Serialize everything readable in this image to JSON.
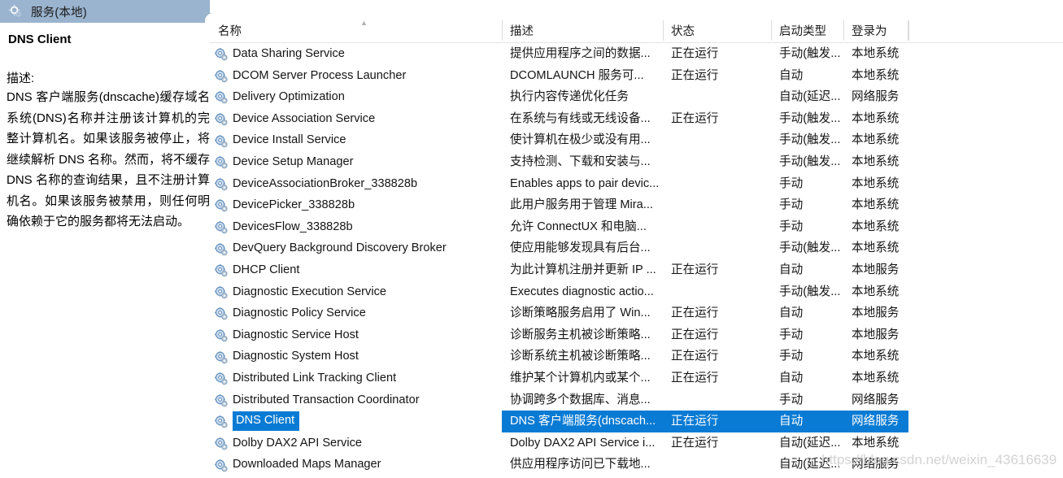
{
  "window": {
    "title": "服务(本地)",
    "title_icon": "services-gear-icon"
  },
  "detail_pane": {
    "service_name": "DNS Client",
    "description_label": "描述:",
    "description_text": "DNS 客户端服务(dnscache)缓存域名系统(DNS)名称并注册该计算机的完整计算机名。如果该服务被停止，将继续解析 DNS 名称。然而，将不缓存 DNS 名称的查询结果，且不注册计算机名。如果该服务被禁用，则任何明确依赖于它的服务都将无法启动。"
  },
  "list": {
    "columns": [
      {
        "key": "name",
        "label": "名称",
        "sorted": "asc",
        "sort_glyph": "▲"
      },
      {
        "key": "description",
        "label": "描述"
      },
      {
        "key": "status",
        "label": "状态"
      },
      {
        "key": "startup_type",
        "label": "启动类型"
      },
      {
        "key": "log_on_as",
        "label": "登录为"
      }
    ],
    "selected_index": 17,
    "selection_color": "#0a7bd4",
    "rows": [
      {
        "name": "Data Sharing Service",
        "description": "提供应用程序之间的数据...",
        "status": "正在运行",
        "startup_type": "手动(触发...",
        "log_on_as": "本地系统"
      },
      {
        "name": "DCOM Server Process Launcher",
        "description": "DCOMLAUNCH 服务可...",
        "status": "正在运行",
        "startup_type": "自动",
        "log_on_as": "本地系统"
      },
      {
        "name": "Delivery Optimization",
        "description": "执行内容传递优化任务",
        "status": "",
        "startup_type": "自动(延迟...",
        "log_on_as": "网络服务"
      },
      {
        "name": "Device Association Service",
        "description": "在系统与有线或无线设备...",
        "status": "正在运行",
        "startup_type": "手动(触发...",
        "log_on_as": "本地系统"
      },
      {
        "name": "Device Install Service",
        "description": "使计算机在极少或没有用...",
        "status": "",
        "startup_type": "手动(触发...",
        "log_on_as": "本地系统"
      },
      {
        "name": "Device Setup Manager",
        "description": "支持检测、下载和安装与...",
        "status": "",
        "startup_type": "手动(触发...",
        "log_on_as": "本地系统"
      },
      {
        "name": "DeviceAssociationBroker_338828b",
        "description": "Enables apps to pair devic...",
        "status": "",
        "startup_type": "手动",
        "log_on_as": "本地系统"
      },
      {
        "name": "DevicePicker_338828b",
        "description": "此用户服务用于管理 Mira...",
        "status": "",
        "startup_type": "手动",
        "log_on_as": "本地系统"
      },
      {
        "name": "DevicesFlow_338828b",
        "description": "允许 ConnectUX 和电脑...",
        "status": "",
        "startup_type": "手动",
        "log_on_as": "本地系统"
      },
      {
        "name": "DevQuery Background Discovery Broker",
        "description": "使应用能够发现具有后台...",
        "status": "",
        "startup_type": "手动(触发...",
        "log_on_as": "本地系统"
      },
      {
        "name": "DHCP Client",
        "description": "为此计算机注册并更新 IP ...",
        "status": "正在运行",
        "startup_type": "自动",
        "log_on_as": "本地服务"
      },
      {
        "name": "Diagnostic Execution Service",
        "description": "Executes diagnostic actio...",
        "status": "",
        "startup_type": "手动(触发...",
        "log_on_as": "本地系统"
      },
      {
        "name": "Diagnostic Policy Service",
        "description": "诊断策略服务启用了 Win...",
        "status": "正在运行",
        "startup_type": "自动",
        "log_on_as": "本地服务"
      },
      {
        "name": "Diagnostic Service Host",
        "description": "诊断服务主机被诊断策略...",
        "status": "正在运行",
        "startup_type": "手动",
        "log_on_as": "本地服务"
      },
      {
        "name": "Diagnostic System Host",
        "description": "诊断系统主机被诊断策略...",
        "status": "正在运行",
        "startup_type": "手动",
        "log_on_as": "本地系统"
      },
      {
        "name": "Distributed Link Tracking Client",
        "description": "维护某个计算机内或某个...",
        "status": "正在运行",
        "startup_type": "自动",
        "log_on_as": "本地系统"
      },
      {
        "name": "Distributed Transaction Coordinator",
        "description": "协调跨多个数据库、消息...",
        "status": "",
        "startup_type": "手动",
        "log_on_as": "网络服务"
      },
      {
        "name": "DNS Client",
        "description": "DNS 客户端服务(dnscach...",
        "status": "正在运行",
        "startup_type": "自动",
        "log_on_as": "网络服务"
      },
      {
        "name": "Dolby DAX2 API Service",
        "description": "Dolby DAX2 API Service i...",
        "status": "正在运行",
        "startup_type": "自动(延迟...",
        "log_on_as": "本地系统"
      },
      {
        "name": "Downloaded Maps Manager",
        "description": "供应用程序访问已下载地...",
        "status": "",
        "startup_type": "自动(延迟...",
        "log_on_as": "网络服务"
      }
    ]
  },
  "watermark": {
    "text": "https://blog.csdn.net/weixin_43616639"
  }
}
